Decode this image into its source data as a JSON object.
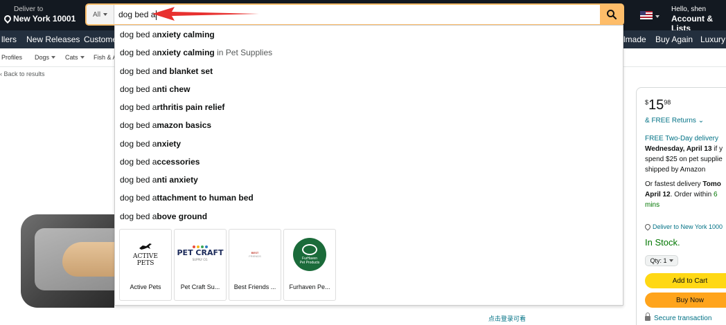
{
  "header": {
    "deliver_small": "Deliver to",
    "deliver_big": "New York 10001",
    "search_category": "All",
    "search_query": "dog bed a",
    "account_small": "Hello, shen",
    "account_big": "Account & Lists"
  },
  "navbar": {
    "items": [
      "llers",
      "New Releases",
      "Custome",
      "lmade",
      "Buy Again",
      "Luxury S"
    ]
  },
  "subnav": {
    "items": [
      "Profiles",
      "Dogs",
      "Cats",
      "Fish & A"
    ]
  },
  "back_link": "Back to results",
  "suggestions": [
    {
      "prefix": "dog bed a",
      "rest": "nxiety calming",
      "category": ""
    },
    {
      "prefix": "dog bed a",
      "rest": "nxiety calming",
      "category": " in Pet Supplies"
    },
    {
      "prefix": "dog bed a",
      "rest": "nd blanket set",
      "category": ""
    },
    {
      "prefix": "dog bed a",
      "rest": "nti chew",
      "category": ""
    },
    {
      "prefix": "dog bed a",
      "rest": "rthritis pain relief",
      "category": ""
    },
    {
      "prefix": "dog bed a",
      "rest": "mazon basics",
      "category": ""
    },
    {
      "prefix": "dog bed a",
      "rest": "nxiety",
      "category": ""
    },
    {
      "prefix": "dog bed a",
      "rest": "ccessories",
      "category": ""
    },
    {
      "prefix": "dog bed a",
      "rest": "nti anxiety",
      "category": ""
    },
    {
      "prefix": "dog bed a",
      "rest": "ttachment to human bed",
      "category": ""
    },
    {
      "prefix": "dog bed a",
      "rest": "bove ground",
      "category": ""
    }
  ],
  "brands": [
    {
      "name": "Active Pets",
      "logo_text_1": "ACTIVE",
      "logo_text_2": "PETS"
    },
    {
      "name": "Pet Craft Su...",
      "logo_text_1": "PET CRAFT",
      "logo_text_2": "SUPPLY CO."
    },
    {
      "name": "Best Friends ...",
      "logo_text_1": "BEST",
      "logo_text_2": "FRIENDS"
    },
    {
      "name": "Furhaven Pe...",
      "logo_text_1": "FurHaven",
      "logo_text_2": "Pet Products"
    }
  ],
  "buybox": {
    "currency": "$",
    "price_whole": "15",
    "price_fraction": "98",
    "returns": "& FREE Returns",
    "free_delivery": "FREE Two-Day delivery",
    "delivery_date": "Wednesday, April 13",
    "delivery_cond_1": "if y",
    "delivery_cond_2": "spend $25 on pet supplie",
    "delivery_cond_3": "shipped by Amazon",
    "fastest_1": "Or fastest delivery",
    "fastest_bold": "Tomo",
    "fastest_2": "April 12",
    "fastest_3": ". Order within",
    "fastest_4": "6",
    "fastest_5": "mins",
    "deliver_to": "Deliver to New York 1000",
    "stock": "In Stock.",
    "qty": "Qty: 1",
    "add_to_cart": "Add to Cart",
    "buy_now": "Buy Now",
    "secure": "Secure transaction"
  },
  "scan_text": "点击登录可看",
  "colors": {
    "nav_dark": "#131921",
    "nav_secondary": "#232f3e",
    "search_accent": "#febd69",
    "arrow_red": "#e8312f",
    "link_teal": "#007185",
    "stock_green": "#007600"
  }
}
